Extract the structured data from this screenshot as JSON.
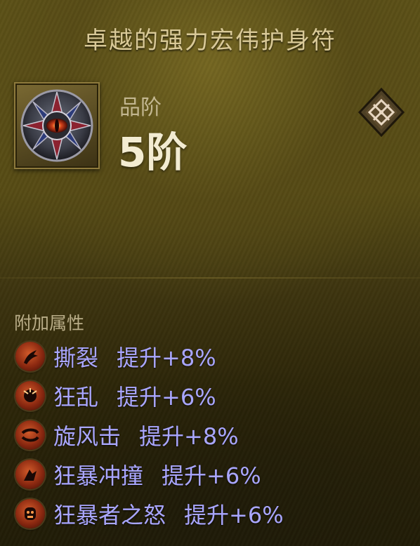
{
  "item": {
    "name": "卓越的强力宏伟护身符",
    "grade_label": "品阶",
    "grade_value": "5阶",
    "icon": "amulet-icon"
  },
  "corner_icon": "diamond-sigil-icon",
  "affixes": {
    "header": "附加属性",
    "color": "#a9a6ff",
    "items": [
      {
        "name": "撕裂",
        "value": "提升+8%",
        "icon": "rend-skill-icon"
      },
      {
        "name": "狂乱",
        "value": "提升+6%",
        "icon": "frenzy-skill-icon"
      },
      {
        "name": "旋风击",
        "value": "提升+8%",
        "icon": "whirlwind-skill-icon"
      },
      {
        "name": "狂暴冲撞",
        "value": "提升+6%",
        "icon": "rushing-charge-skill-icon"
      },
      {
        "name": "狂暴者之怒",
        "value": "提升+6%",
        "icon": "berserker-rage-skill-icon"
      }
    ]
  }
}
